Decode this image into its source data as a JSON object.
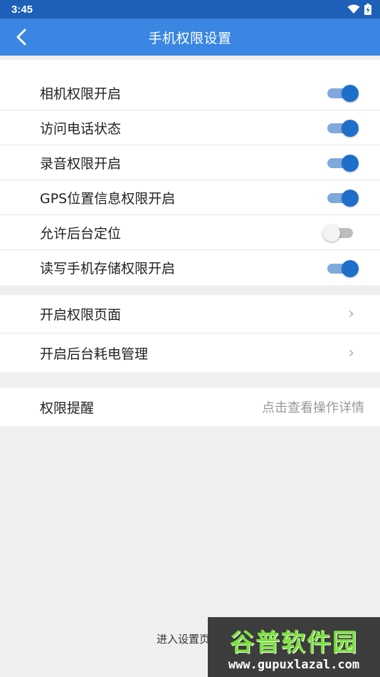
{
  "status": {
    "time": "3:45"
  },
  "header": {
    "title": "手机权限设置"
  },
  "permissions": [
    {
      "label": "相机权限开启",
      "on": true
    },
    {
      "label": "访问电话状态",
      "on": true
    },
    {
      "label": "录音权限开启",
      "on": true
    },
    {
      "label": "GPS位置信息权限开启",
      "on": true
    },
    {
      "label": "允许后台定位",
      "on": false
    },
    {
      "label": "读写手机存储权限开启",
      "on": true
    }
  ],
  "links": [
    {
      "label": "开启权限页面"
    },
    {
      "label": "开启后台耗电管理"
    }
  ],
  "reminder": {
    "label": "权限提醒",
    "detail": "点击查看操作详情"
  },
  "footer": {
    "text": "进入设置页"
  },
  "watermark": {
    "title": "谷普软件园",
    "url": "www.gupuxlazal.com"
  },
  "colors": {
    "status_bar": "#1e5fb8",
    "app_bar": "#3a86e2",
    "switch_on": "#1e6fc9",
    "background": "#efefef"
  }
}
